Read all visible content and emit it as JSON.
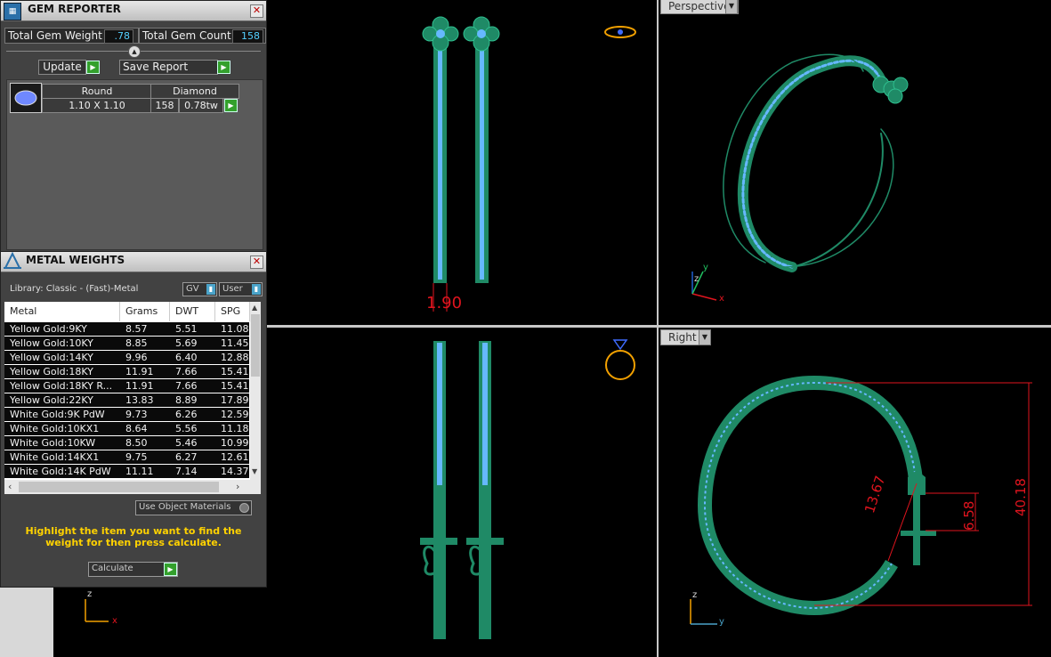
{
  "gem_reporter": {
    "title": "GEM REPORTER",
    "total_weight_label": "Total Gem Weight",
    "total_weight_value": ".78",
    "total_count_label": "Total Gem Count",
    "total_count_value": "158",
    "update_label": "Update",
    "save_report_label": "Save Report",
    "gem": {
      "shape_header": "Round",
      "type_header": "Diamond",
      "size": "1.10 X 1.10",
      "count": "158",
      "weight": "0.78tw"
    }
  },
  "metal_weights": {
    "title": "METAL WEIGHTS",
    "library_label": "Library: Classic - (Fast)-Metal",
    "gv_label": "GV",
    "user_label": "User",
    "columns": [
      "Metal",
      "Grams",
      "DWT",
      "SPG"
    ],
    "rows": [
      [
        "Yellow Gold:9KY",
        "8.57",
        "5.51",
        "11.08"
      ],
      [
        "Yellow Gold:10KY",
        "8.85",
        "5.69",
        "11.45"
      ],
      [
        "Yellow Gold:14KY",
        "9.96",
        "6.40",
        "12.88"
      ],
      [
        "Yellow Gold:18KY",
        "11.91",
        "7.66",
        "15.41"
      ],
      [
        "Yellow Gold:18KY R...",
        "11.91",
        "7.66",
        "15.41"
      ],
      [
        "Yellow Gold:22KY",
        "13.83",
        "8.89",
        "17.89"
      ],
      [
        "White Gold:9K PdW",
        "9.73",
        "6.26",
        "12.59"
      ],
      [
        "White Gold:10KX1",
        "8.64",
        "5.56",
        "11.18"
      ],
      [
        "White Gold:10KW",
        "8.50",
        "5.46",
        "10.99"
      ],
      [
        "White Gold:14KX1",
        "9.75",
        "6.27",
        "12.61"
      ],
      [
        "White Gold:14K PdW",
        "11.11",
        "7.14",
        "14.37"
      ]
    ],
    "use_object_materials": "Use Object Materials",
    "instruction": "Highlight the item you want to find the weight for then press calculate.",
    "calculate_label": "Calculate"
  },
  "viewports": {
    "perspective_label": "Perspective",
    "right_label": "Right",
    "dim_top": "1.90",
    "dim_a": "13.67",
    "dim_b": "6.58",
    "dim_c": "40.18",
    "axis_z": "z",
    "axis_x": "x",
    "axis_y": "y"
  },
  "colors": {
    "metal_green": "#1f8a66",
    "gem_blue": "#66b8ff",
    "dimension_red": "#e0141e",
    "panel_bg": "#424242",
    "instruction_yellow": "#ffd200"
  }
}
